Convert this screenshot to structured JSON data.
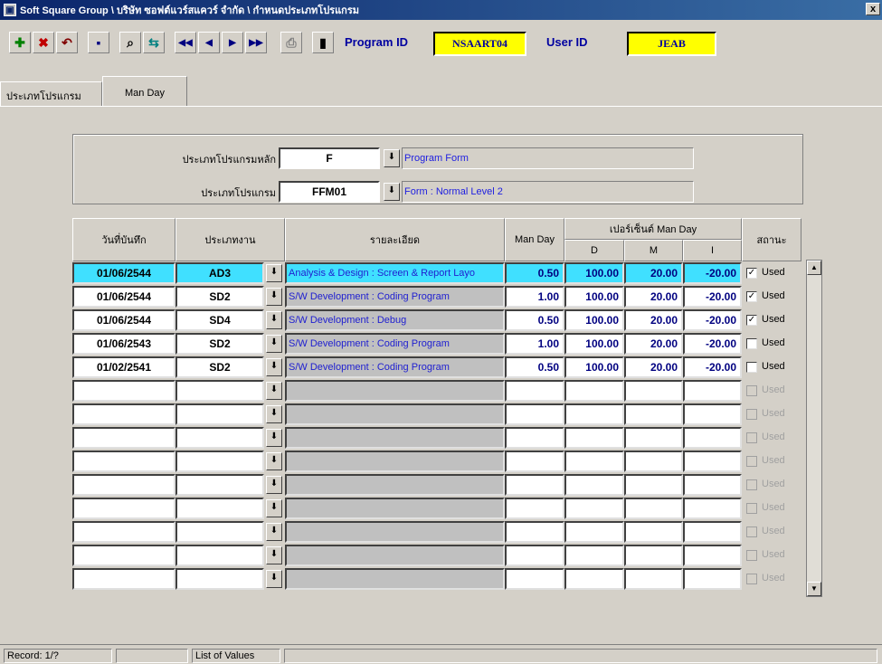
{
  "window": {
    "title": "Soft Square Group \\ บริษัท ซอฟต์แวร์สแควร์ จำกัด \\ กำหนดประเภทโปรแกรม",
    "close_glyph": "x"
  },
  "toolbar": {
    "program_id_label": "Program ID",
    "program_id_value": "NSAART04",
    "user_id_label": "User ID",
    "user_id_value": "JEAB",
    "icons": [
      "add-icon",
      "delete-icon",
      "undo-icon",
      "save-icon",
      "binoculars-icon",
      "query-icon",
      "first-record-icon",
      "prev-record-icon",
      "next-record-icon",
      "last-record-icon",
      "print-icon",
      "exit-icon"
    ]
  },
  "tabs": [
    {
      "label": "ประเภทโปรแกรม"
    },
    {
      "label": "Man Day"
    }
  ],
  "header": {
    "main_type_label": "ประเภทโปรแกรมหลัก",
    "main_type_code": "F",
    "main_type_desc": "Program Form",
    "type_label": "ประเภทโปรแกรม",
    "type_code": "FFM01",
    "type_desc": "Form : Normal Level 2"
  },
  "grid": {
    "columns": {
      "date": "วันที่บันทึก",
      "work_type": "ประเภทงาน",
      "detail": "รายละเอียด",
      "man_day": "Man Day",
      "percent_group": "เปอร์เซ็นต์ Man Day",
      "d": "D",
      "m": "M",
      "i": "I",
      "status": "สถานะ"
    },
    "rows": [
      {
        "date": "01/06/2544",
        "type": "AD3",
        "detail": "Analysis & Design : Screen & Report Layo",
        "man_day": "0.50",
        "d": "100.00",
        "m": "20.00",
        "i": "-20.00",
        "used": "Used",
        "checked": "✓"
      },
      {
        "date": "01/06/2544",
        "type": "SD2",
        "detail": "S/W Development : Coding Program",
        "man_day": "1.00",
        "d": "100.00",
        "m": "20.00",
        "i": "-20.00",
        "used": "Used",
        "checked": "✓"
      },
      {
        "date": "01/06/2544",
        "type": "SD4",
        "detail": "S/W Development : Debug",
        "man_day": "0.50",
        "d": "100.00",
        "m": "20.00",
        "i": "-20.00",
        "used": "Used",
        "checked": "✓"
      },
      {
        "date": "01/06/2543",
        "type": "SD2",
        "detail": "S/W Development : Coding Program",
        "man_day": "1.00",
        "d": "100.00",
        "m": "20.00",
        "i": "-20.00",
        "used": "Used",
        "checked": ""
      },
      {
        "date": "01/02/2541",
        "type": "SD2",
        "detail": "S/W Development : Coding Program",
        "man_day": "0.50",
        "d": "100.00",
        "m": "20.00",
        "i": "-20.00",
        "used": "Used",
        "checked": ""
      }
    ],
    "empty_used_label": "Used",
    "empty_row_count": 9
  },
  "status": {
    "record": "Record: 1/?",
    "hint": "List of Values"
  },
  "colors": {
    "active_row": "#40e0ff",
    "highlight": "#ffff00",
    "title_bar": "#0a246a",
    "desc_text": "#2020d0"
  }
}
